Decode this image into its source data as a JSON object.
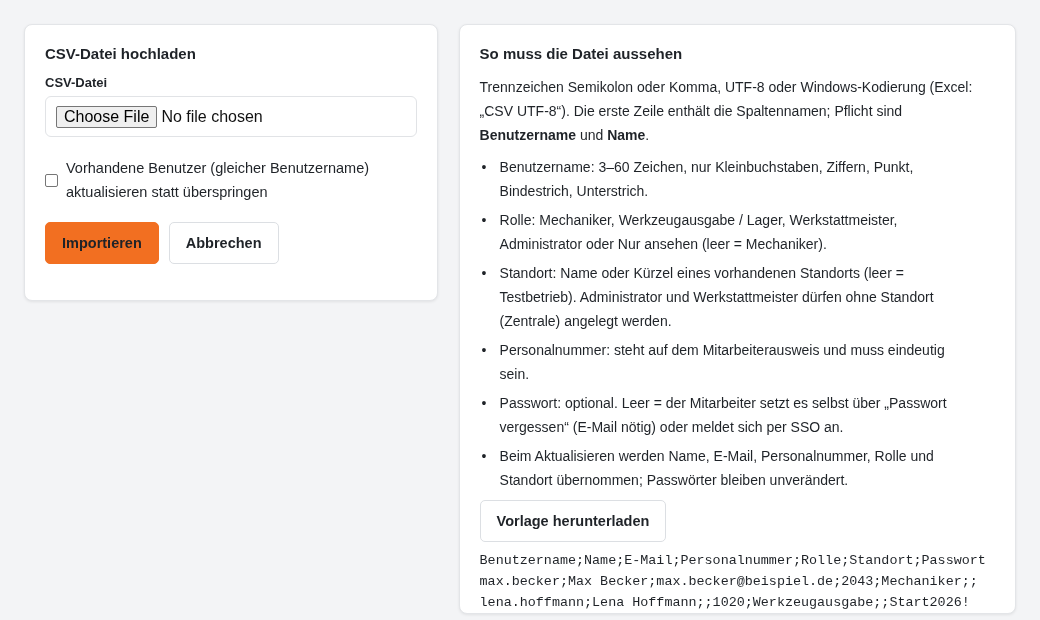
{
  "upload_card": {
    "title": "CSV-Datei hochladen",
    "file_label": "CSV-Datei",
    "file_button": "Choose File",
    "file_status": "No file chosen",
    "update_option": {
      "label": "Vorhandene Benutzer (gleicher Benutzername) aktualisieren statt überspringen",
      "checked": false
    },
    "buttons": [
      {
        "label": "Importieren",
        "kind": "primary"
      },
      {
        "label": "Abbrechen",
        "kind": "secondary"
      }
    ]
  },
  "help_card": {
    "title": "So muss die Datei aussehen",
    "intro": "Trennzeichen Semikolon oder Komma, UTF-8 oder Windows-Kodierung (Excel: „CSV UTF-8“). Die erste Zeile enthält die Spaltennamen; Pflicht sind **Benutzername** und **Name**.",
    "rules": [
      {
        "marker": "•",
        "text": "Benutzername: 3–60 Zeichen, nur Kleinbuchstaben, Ziffern, Punkt, Bindestrich, Unterstrich."
      },
      {
        "marker": "•",
        "text": "Rolle: Mechaniker, Werkzeugausgabe / Lager, Werkstattmeister, Administrator oder Nur ansehen (leer = Mechaniker)."
      },
      {
        "marker": "•",
        "text": "Standort: Name oder Kürzel eines vorhandenen Standorts (leer = Testbetrieb). Administrator und Werkstattmeister dürfen ohne Standort (Zentrale) angelegt werden."
      },
      {
        "marker": "•",
        "text": "Personalnummer: steht auf dem Mitarbeiterausweis und muss eindeutig sein."
      },
      {
        "marker": "•",
        "text": "Passwort: optional. Leer = der Mitarbeiter setzt es selbst über „Passwort vergessen“ (E-Mail nötig) oder meldet sich per SSO an."
      },
      {
        "marker": "•",
        "text": "Beim Aktualisieren werden Name, E-Mail, Personalnummer, Rolle und Standort übernommen; Passwörter bleiben unverändert."
      }
    ],
    "download_button": "Vorlage herunterladen",
    "sample_lines": [
      "Benutzername;Name;E-Mail;Personalnummer;Rolle;Standort;Passwort",
      "max.becker;Max Becker;max.becker@beispiel.de;2043;Mechaniker;;",
      "lena.hoffmann;Lena Hoffmann;;1020;Werkzeugausgabe;;Start2026!"
    ]
  }
}
